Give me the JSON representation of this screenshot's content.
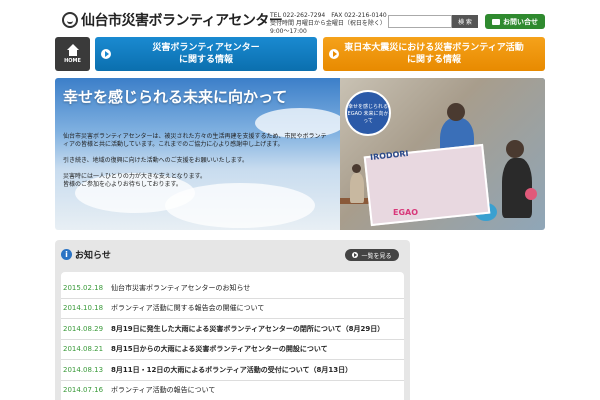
{
  "header": {
    "logo_text": "仙台市災害ボランティアセンター",
    "contact_line1": "TEL 022-262-7294　FAX 022-216-0140",
    "contact_line2": "受付時間 月曜日から金曜日（祝日を除く）",
    "contact_line3": "9:00～17:00",
    "search_placeholder": "",
    "search_button": "検 索",
    "inquiry_label": "お問い合せ"
  },
  "nav": {
    "home_label": "HOME",
    "blue_line1": "災害ボランティアセンター",
    "blue_line2": "に関する情報",
    "orange_line1": "東日本大震災における災害ボランティア活動",
    "orange_line2": "に関する情報"
  },
  "hero": {
    "title": "幸せを感じられる未来に向かって",
    "body1": "仙台市災害ボランティアセンターは、被災された方々の生活再建を支援するため、市民やボランティアの皆様と共に活動しています。これまでのご協力に心より感謝申し上げます。",
    "body2": "引き続き、地域の復興に向けた活動へのご支援をお願いいたします。",
    "body3": "災害時には一人ひとりの力が大きな支えとなります。",
    "body4": "皆様のご参加を心よりお待ちしております。",
    "badge_text": "幸せを感じられる EGAO 未来に向かって",
    "banner_text": "IRODORI",
    "banner_ega": "EGAO"
  },
  "news": {
    "title": "お知らせ",
    "more_label": "一覧を見る",
    "items": [
      {
        "date": "2015.02.18",
        "text": "仙台市災害ボランティアセンターのお知らせ",
        "bold": false
      },
      {
        "date": "2014.10.18",
        "text": "ボランティア活動に関する報告会の開催について",
        "bold": false
      },
      {
        "date": "2014.08.29",
        "text": "8月19日に発生した大雨による災害ボランティアセンターの閉所について（8月29日）",
        "bold": true
      },
      {
        "date": "2014.08.21",
        "text": "8月15日からの大雨による災害ボランティアセンターの開設について",
        "bold": true
      },
      {
        "date": "2014.08.13",
        "text": "8月11日・12日の大雨によるボランティア活動の受付について（8月13日）",
        "bold": true
      },
      {
        "date": "2014.07.16",
        "text": "ボランティア活動の報告について",
        "bold": false
      }
    ]
  }
}
